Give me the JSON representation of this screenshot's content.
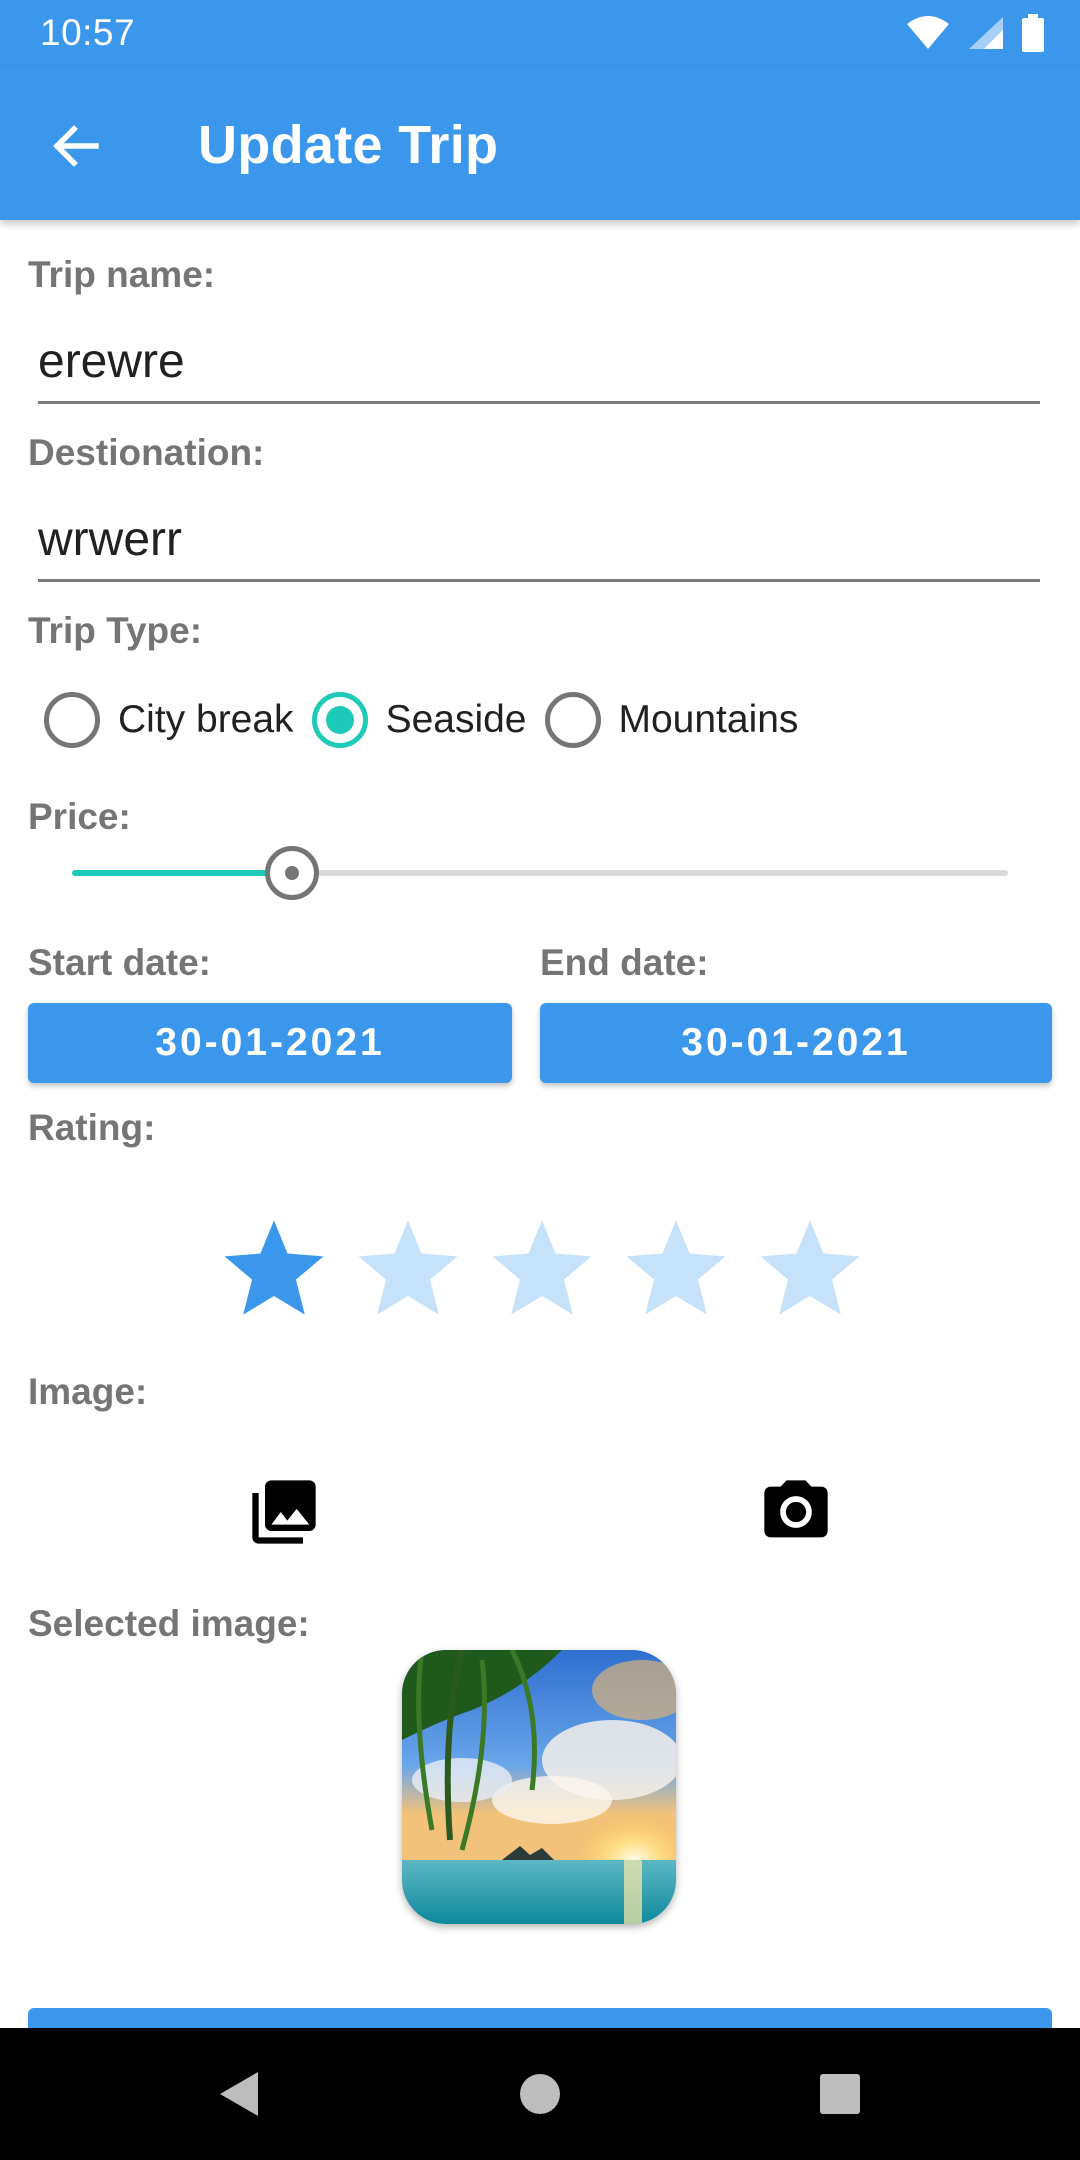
{
  "status_bar": {
    "time": "10:57",
    "icons": [
      "wifi-icon",
      "signal-icon",
      "battery-icon"
    ]
  },
  "app_bar": {
    "title": "Update Trip",
    "back_icon": "arrow-back-icon"
  },
  "form": {
    "trip_name": {
      "label": "Trip name:",
      "value": "erewre"
    },
    "destination": {
      "label": "Destionation:",
      "value": "wrwerr"
    },
    "trip_type": {
      "label": "Trip Type:",
      "options": [
        "City break",
        "Seaside",
        "Mountains"
      ],
      "selected": "Seaside"
    },
    "price": {
      "label": "Price:",
      "value_fraction": 0.235
    },
    "start_date": {
      "label": "Start date:",
      "value": "30-01-2021"
    },
    "end_date": {
      "label": "End date:",
      "value": "30-01-2021"
    },
    "rating": {
      "label": "Rating:",
      "value": 1,
      "max": 5
    },
    "image": {
      "label": "Image:",
      "gallery_icon": "photo-library-icon",
      "camera_icon": "camera-icon"
    },
    "selected_image": {
      "label": "Selected image:",
      "description_icon": "beach-sunset-photo"
    }
  },
  "nav_bar": {
    "icons": [
      "back-triangle-icon",
      "home-circle-icon",
      "recents-square-icon"
    ]
  },
  "colors": {
    "primary": "#3b97ec",
    "accent": "#1dc9b7",
    "star_empty": "#c6e2fb",
    "label": "#757575"
  }
}
